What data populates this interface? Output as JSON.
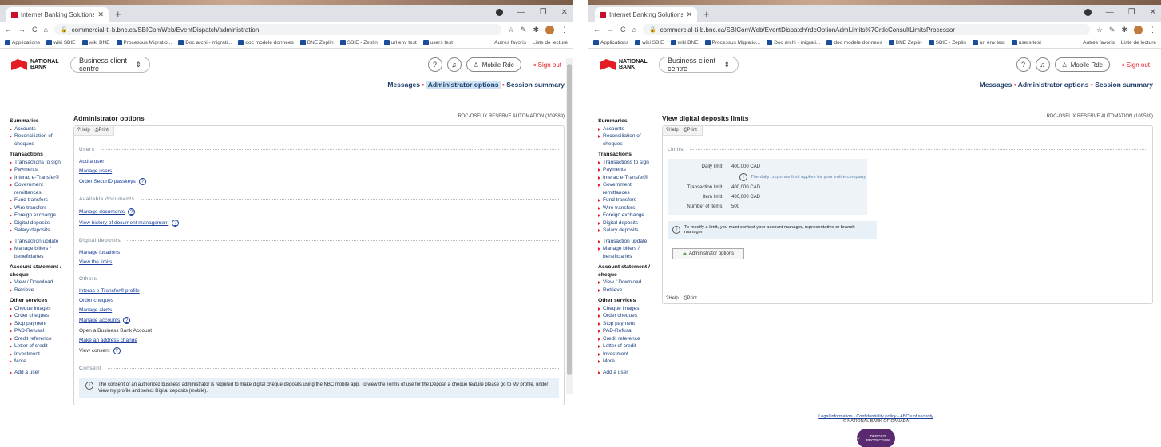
{
  "left": {
    "tab_title": "Internet Banking Solutions — Bu...",
    "url": "commercial-ti-b.bnc.ca/SBIComWeb/EventDispatch/administration",
    "bookmarks": [
      "Applications",
      "wiki SBIE",
      "wiki BNE",
      "Processus Migratio...",
      "Doc archi - migrati...",
      "doc modele donnees",
      "BNE Zeplin",
      "SBIE - Zeplin",
      "url env test",
      "users test"
    ],
    "bookmarks_right": [
      "Autres favoris",
      "Liste de lecture"
    ],
    "page_title": "Administrator options",
    "client_name": "RDC-OSELIX RESERVE AUTOMATION (109589)",
    "help": "Help",
    "print": "Print",
    "sections": {
      "users": {
        "title": "Users",
        "links": [
          "Add a user",
          "Manage users",
          "Order SecurID passkeys"
        ]
      },
      "documents": {
        "title": "Available documents",
        "links": [
          "Manage documents",
          "View history of document management"
        ]
      },
      "digital": {
        "title": "Digital deposits",
        "links": [
          "Manage locations",
          "View the limits"
        ]
      },
      "others": {
        "title": "Others",
        "links": [
          "Interac e-Transfer® profile",
          "Order cheques",
          "Manage alerts",
          "Manage accounts",
          "Open a Business Bank Account",
          "Make an address change",
          "View consent"
        ]
      },
      "consent": {
        "title": "Consent",
        "text": "The consent of an authorized business administrator is required to make digital cheque deposits using the NBC mobile app. To view the Terms of use for the Deposit a cheque feature please go to My profile, under View my profile and select Digital deposits (mobile)."
      }
    }
  },
  "right": {
    "tab_title": "Internet Banking Solutions — Bu...",
    "url": "commercial-ti-b.bnc.ca/SBIComWeb/EventDispatch/rdcOptionAdmLimits%7CrdcConsultLimitsProcessor",
    "page_title": "View digital deposits limits",
    "client_name": "RDC-OSELIX RESERVE AUTOMATION (109589)",
    "help": "Help",
    "print": "Print",
    "limits_title": "Limits",
    "daily_label": "Daily limit:",
    "daily_value": "400,000 CAD",
    "daily_note": "The daily corporate limit applies for your entire company.",
    "transaction_label": "Transaction limit:",
    "transaction_value": "400,000 CAD",
    "item_label": "Item limit:",
    "item_value": "400,000 CAD",
    "items_label": "Number of items:",
    "items_value": "500",
    "modify_note": "To modify a limit, you must contact your account manager, representative or branch manager.",
    "admin_button": "Administrator options",
    "footer_links": "Legal information - Confidentiality policy - ABC's of security",
    "footer_copy": "© NATIONAL BANK OF CANADA",
    "deposit_badge": "DEPOSIT PROTECTION"
  },
  "common": {
    "bank_name_1": "NATIONAL",
    "bank_name_2": "BANK",
    "business_centre": "Business client centre",
    "mobile": "Mobile Rdc",
    "signout": "Sign out",
    "crumb_messages": "Messages",
    "crumb_admin": "Administrator options",
    "crumb_session": "Session summary",
    "sidebar": {
      "summaries": "Summaries",
      "summaries_items": [
        "Accounts",
        "Reconciliation of cheques"
      ],
      "transactions": "Transactions",
      "transactions_items": [
        "Transactions to sign",
        "Payments",
        "Interac e-Transfer®",
        "Government remittances",
        "Fund transfers",
        "Wire transfers",
        "Foreign exchange",
        "Digital deposits",
        "Salary deposits"
      ],
      "update_items": [
        "Transaction update",
        "Manage billers / beneficiaries"
      ],
      "statement": "Account statement / cheque",
      "statement_items": [
        "View / Download",
        "Retrieve"
      ],
      "other": "Other services",
      "other_items": [
        "Cheque images",
        "Order cheques",
        "Stop payment",
        "PAD-Refusal",
        "Credit reference",
        "Letter of credit",
        "Investment",
        "More"
      ],
      "add_user": "Add a user"
    }
  }
}
